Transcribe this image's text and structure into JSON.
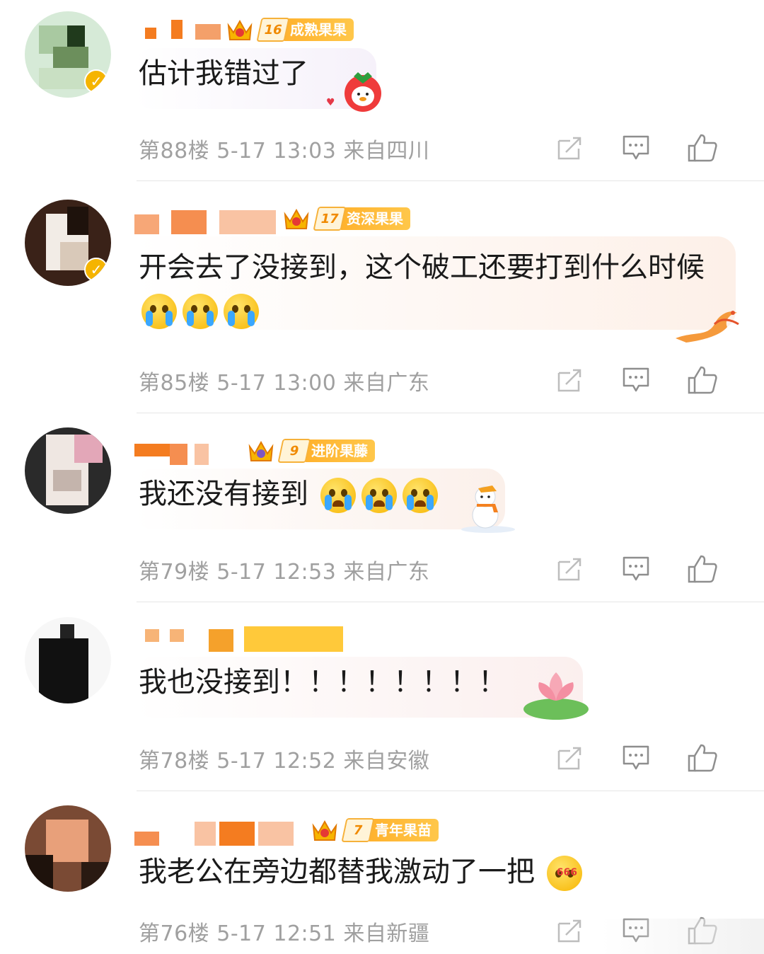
{
  "comments": [
    {
      "level_num": "16",
      "level_title": "成熟果果",
      "text": "估计我错过了",
      "emojis": [],
      "floor": "第88楼",
      "time": "5-17 13:03",
      "location": "来自四川",
      "bubble_deco": "strawberry-duck-sticker"
    },
    {
      "level_num": "17",
      "level_title": "资深果果",
      "text": "开会去了没接到，这个破工还要打到什么时候",
      "emojis": [
        "crying-emoji",
        "crying-emoji",
        "crying-emoji"
      ],
      "floor": "第85楼",
      "time": "5-17 13:00",
      "location": "来自广东",
      "bubble_deco": "phoenix-sticker"
    },
    {
      "level_num": "9",
      "level_title": "进阶果藤",
      "text": "我还没有接到",
      "emojis": [
        "bawling-emoji",
        "bawling-emoji",
        "bawling-emoji"
      ],
      "floor": "第79楼",
      "time": "5-17 12:53",
      "location": "来自广东",
      "bubble_deco": "snowman-sticker"
    },
    {
      "level_num": "",
      "level_title": "",
      "text": "我也没接到！！！！！！！！",
      "emojis": [],
      "floor": "第78楼",
      "time": "5-17 12:52",
      "location": "来自安徽",
      "bubble_deco": "lotus-sticker"
    },
    {
      "level_num": "7",
      "level_title": "青年果苗",
      "text": "我老公在旁边都替我激动了一把",
      "emojis": [
        "666-emoji"
      ],
      "floor": "第76楼",
      "time": "5-17 12:51",
      "location": "来自新疆",
      "bubble_deco": ""
    }
  ],
  "icons": {
    "share": "share-icon",
    "reply": "comment-icon",
    "like": "thumbs-up-icon"
  },
  "colors": {
    "level_badge": "#ffb22e",
    "meta_text": "#a0a0a0",
    "name_mosaic": "#f47c20"
  }
}
